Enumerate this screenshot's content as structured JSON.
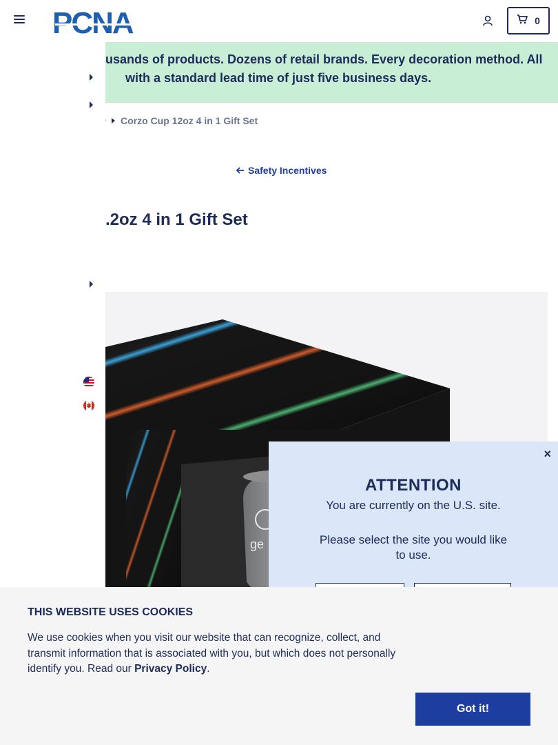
{
  "header": {
    "logo_text": "PCNA",
    "cart_count": "0"
  },
  "banner": {
    "line1": "usands of products. Dozens of retail brands. Every decoration method. All",
    "line2": "with a standard lead time of just five business days."
  },
  "breadcrumb": {
    "current": "Corzo Cup 12oz 4 in 1 Gift Set"
  },
  "back_link": {
    "label": "Safety Incentives"
  },
  "product": {
    "title": ".2oz 4 in 1 Gift Set",
    "image_logo_text": "ge"
  },
  "attention_modal": {
    "close_glyph": "×",
    "heading": "ATTENTION",
    "message": "You are currently on the U.S. site.",
    "prompt": "Please select the site you would like to use."
  },
  "cookie_banner": {
    "heading": "THIS WEBSITE USES COOKIES",
    "body": "We use cookies when you visit our website that can recognize, collect, and transmit information that is associated with you, but which does not personally identify you. Read our ",
    "link_label": "Privacy Policy",
    "body_end": ".",
    "button_label": "Got it!"
  },
  "colors": {
    "brand_navy": "#1d2b5a",
    "brand_blue": "#1d3ea0",
    "banner_green": "#c8efd6",
    "modal_bg": "#dbe6f8"
  },
  "icons": [
    "menu-icon",
    "account-icon",
    "cart-icon",
    "arrow-left-icon",
    "us-flag-icon",
    "canada-flag-icon",
    "close-icon"
  ]
}
